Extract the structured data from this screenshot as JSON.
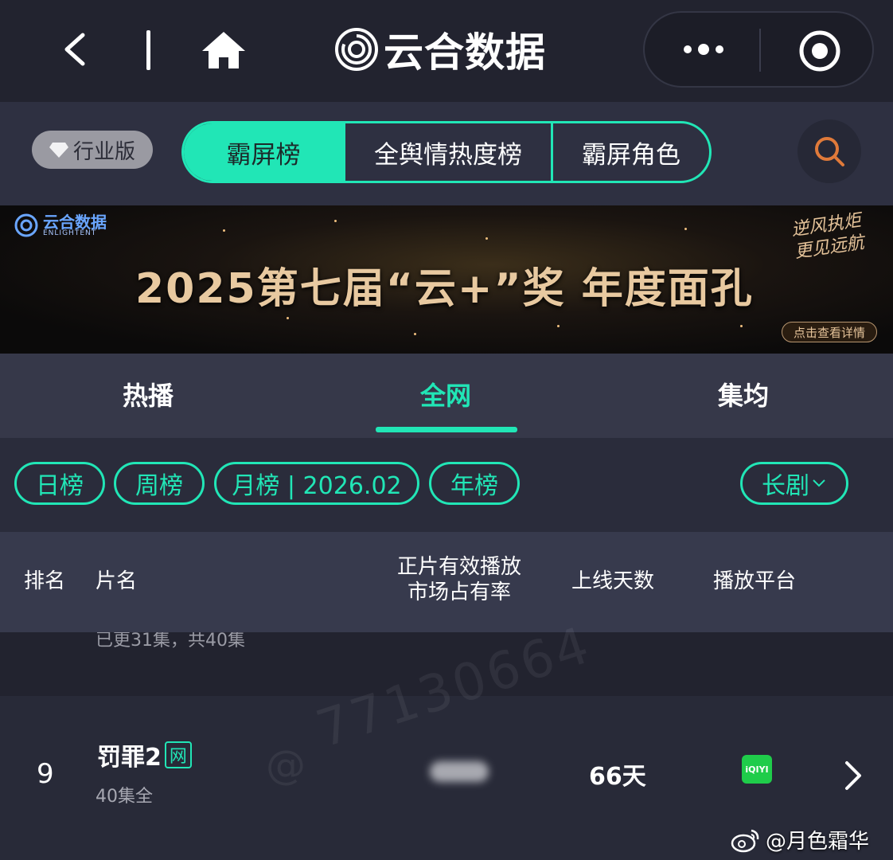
{
  "topbar": {
    "brand_title": "云合数据"
  },
  "segment": {
    "industry_badge": "行业版",
    "tabs": [
      "霸屏榜",
      "全舆情热度榜",
      "霸屏角色"
    ]
  },
  "banner": {
    "logo_main": "云合数据",
    "logo_sub": "ENLIGHTENT",
    "title": "2025第七届“云+”奖 年度面孔",
    "slogan": "逆风执炬 更见远航",
    "cta": "点击查看详情"
  },
  "category_tabs": [
    "热播",
    "全网",
    "集均"
  ],
  "chips": {
    "day": "日榜",
    "week": "周榜",
    "month": "月榜 | 2026.02",
    "year": "年榜",
    "type": "长剧"
  },
  "table": {
    "headers": {
      "rank": "排名",
      "name": "片名",
      "share_line1": "正片有效播放",
      "share_line2": "市场占有率",
      "days": "上线天数",
      "platform": "播放平台"
    },
    "partial_row": {
      "episodes": "已更31集，共40集"
    },
    "rows": [
      {
        "rank": "9",
        "title": "罚罪2",
        "badge": "网",
        "episodes": "40集全",
        "days": "66天",
        "platform": "iQIYI"
      }
    ]
  },
  "watermark": {
    "number": "77130664",
    "at": "@"
  },
  "credit": {
    "text": "@月色霜华"
  },
  "colors": {
    "accent": "#21e6b6",
    "background": "#1f2130",
    "platform_green": "#1fcc4a"
  }
}
